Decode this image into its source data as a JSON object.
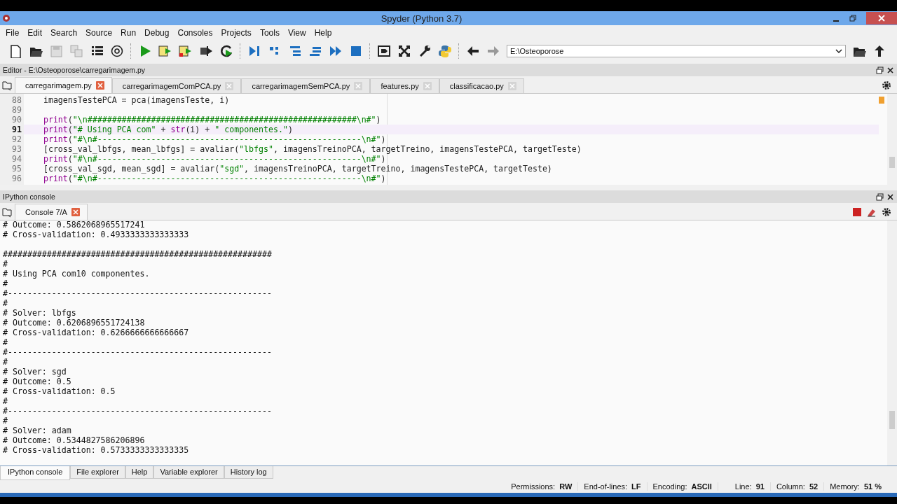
{
  "window": {
    "title": "Spyder (Python 3.7)"
  },
  "menu": [
    "File",
    "Edit",
    "Search",
    "Source",
    "Run",
    "Debug",
    "Consoles",
    "Projects",
    "Tools",
    "View",
    "Help"
  ],
  "path_box": {
    "value": "E:\\Osteoporose"
  },
  "editor": {
    "title": "Editor - E:\\Osteoporose\\carregarimagem.py",
    "tabs": [
      {
        "label": "carregarimagem.py",
        "selected": true
      },
      {
        "label": "carregarimagemComPCA.py",
        "selected": false
      },
      {
        "label": "carregarimagemSemPCA.py",
        "selected": false
      },
      {
        "label": "features.py",
        "selected": false
      },
      {
        "label": "classificacao.py",
        "selected": false
      }
    ],
    "lines": [
      {
        "number": "88",
        "current": false,
        "segments": [
          {
            "kind": "plain",
            "text": "    imagensTestePCA = pca(imagensTeste, i)"
          }
        ]
      },
      {
        "number": "89",
        "current": false
      },
      {
        "number": "90",
        "current": false,
        "segments": [
          {
            "kind": "builtin",
            "text": "    print"
          },
          {
            "kind": "plain",
            "text": "("
          },
          {
            "kind": "string",
            "text": "\"\\n#######################################################\\n#\""
          },
          {
            "kind": "plain",
            "text": ")"
          }
        ]
      },
      {
        "number": "91",
        "current": true,
        "segments": [
          {
            "kind": "builtin",
            "text": "    print"
          },
          {
            "kind": "plain",
            "text": "("
          },
          {
            "kind": "string",
            "text": "\"# Using PCA com\""
          },
          {
            "kind": "plain",
            "text": " + "
          },
          {
            "kind": "builtin",
            "text": "str"
          },
          {
            "kind": "plain",
            "text": "(i) + "
          },
          {
            "kind": "string",
            "text": "\" componentes.\""
          },
          {
            "kind": "plain",
            "text": ")"
          }
        ]
      },
      {
        "number": "92",
        "current": false,
        "segments": [
          {
            "kind": "builtin",
            "text": "    print"
          },
          {
            "kind": "plain",
            "text": "("
          },
          {
            "kind": "string",
            "text": "\"#\\n#------------------------------------------------------\\n#\""
          },
          {
            "kind": "plain",
            "text": ")"
          }
        ]
      },
      {
        "number": "93",
        "current": false,
        "segments": [
          {
            "kind": "plain",
            "text": "    [cross_val_lbfgs, mean_lbfgs] = avaliar("
          },
          {
            "kind": "string",
            "text": "\"lbfgs\""
          },
          {
            "kind": "plain",
            "text": ", imagensTreinoPCA, targetTreino, imagensTestePCA, targetTeste)"
          }
        ]
      },
      {
        "number": "94",
        "current": false,
        "segments": [
          {
            "kind": "builtin",
            "text": "    print"
          },
          {
            "kind": "plain",
            "text": "("
          },
          {
            "kind": "string",
            "text": "\"#\\n#------------------------------------------------------\\n#\""
          },
          {
            "kind": "plain",
            "text": ")"
          }
        ]
      },
      {
        "number": "95",
        "current": false,
        "segments": [
          {
            "kind": "plain",
            "text": "    [cross_val_sgd, mean_sgd] = avaliar("
          },
          {
            "kind": "string",
            "text": "\"sgd\""
          },
          {
            "kind": "plain",
            "text": ", imagensTreinoPCA, targetTreino, imagensTestePCA, targetTeste)"
          }
        ]
      },
      {
        "number": "96",
        "current": false,
        "segments": [
          {
            "kind": "builtin",
            "text": "    print"
          },
          {
            "kind": "plain",
            "text": "("
          },
          {
            "kind": "string",
            "text": "\"#\\n#------------------------------------------------------\\n#\""
          },
          {
            "kind": "plain",
            "text": ")"
          }
        ]
      }
    ]
  },
  "console": {
    "title": "IPython console",
    "tabs": [
      {
        "label": "Console 7/A",
        "selected": true
      }
    ],
    "blocks": [
      [
        "# Outcome: 0.5862068965517241",
        "# Cross-validation: 0.4933333333333333"
      ],
      [
        "#######################################################",
        "#",
        "# Using PCA com10 componentes.",
        "#",
        "#------------------------------------------------------",
        "#",
        "# Solver: lbfgs",
        "# Outcome: 0.6206896551724138",
        "# Cross-validation: 0.6266666666666667",
        "#",
        "#------------------------------------------------------",
        "#",
        "# Solver: sgd",
        "# Outcome: 0.5",
        "# Cross-validation: 0.5",
        "#",
        "#------------------------------------------------------",
        "#",
        "# Solver: adam",
        "# Outcome: 0.5344827586206896",
        "# Cross-validation: 0.5733333333333335"
      ]
    ]
  },
  "bottom_tabs": [
    {
      "label": "IPython console",
      "selected": true
    },
    {
      "label": "File explorer",
      "selected": false
    },
    {
      "label": "Help",
      "selected": false
    },
    {
      "label": "Variable explorer",
      "selected": false
    },
    {
      "label": "History log",
      "selected": false
    }
  ],
  "status_bar": [
    {
      "label": "Permissions:",
      "value": "RW"
    },
    {
      "label": "End-of-lines:",
      "value": "LF"
    },
    {
      "label": "Encoding:",
      "value": "ASCII"
    },
    {
      "label": "Line:",
      "value": "91"
    },
    {
      "label": "Column:",
      "value": "52"
    },
    {
      "label": "Memory:",
      "value": "51 %"
    }
  ]
}
